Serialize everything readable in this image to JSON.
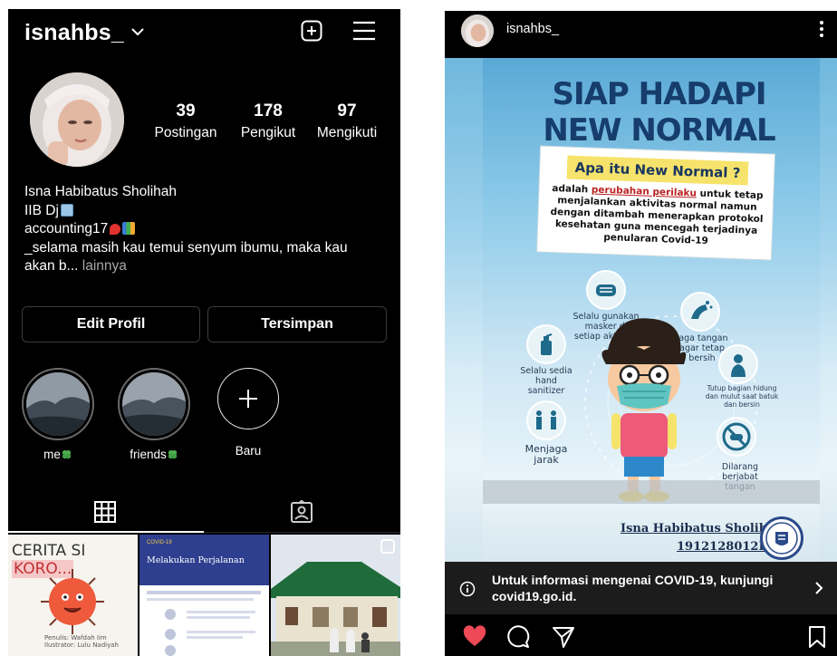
{
  "profile": {
    "username": "isnahbs_",
    "stats": [
      {
        "value": "39",
        "label": "Postingan"
      },
      {
        "value": "178",
        "label": "Pengikut"
      },
      {
        "value": "97",
        "label": "Mengikuti"
      }
    ],
    "bio": {
      "name": "Isna Habibatus Sholihah",
      "line1": "IIB Dj",
      "line2": "accounting17",
      "line3": "_selama masih kau temui senyum ibumu, maka kau",
      "line4": "akan b...",
      "more": "lainnya"
    },
    "buttons": {
      "edit": "Edit Profil",
      "saved": "Tersimpan"
    },
    "highlights": [
      {
        "label": "me"
      },
      {
        "label": "friends"
      },
      {
        "label": "Baru"
      }
    ],
    "thumbs": {
      "t1_title": "CERITA SI",
      "t1_badge": "KORO...",
      "t1_caption": "Penulis: Wafdah Iim\nIlustrator: Lulu Nadiyah",
      "t2_header": "COVID-19",
      "t2_title": "Melakukan Perjalanan"
    }
  },
  "post": {
    "username": "isnahbs_",
    "poster": {
      "title1": "SIAP HADAPI",
      "title2": "NEW NORMAL",
      "question": "Apa itu New Normal ?",
      "def_a": "adalah ",
      "def_hl": "perubahan perilaku",
      "def_b": " untuk tetap menjalankan aktivitas normal namun dengan ditambah menerapkan protokol kesehatan guna mencegah terjadinya penularan Covid-19",
      "tip_mask": "Selalu gunakan masker di setiap aktifitas",
      "tip_hands": "Jaga tangan agar tetap bersih",
      "tip_sanitizer": "Selalu sedia hand sanitizer",
      "tip_cough": "Tutup bagian hidung dan mulut saat batuk dan bersin",
      "tip_distance": "Menjaga jarak",
      "tip_handshake": "Dilarang berjabat tangan",
      "author": "Isna Habibatus Sholihah",
      "nim": "1912128012P"
    },
    "info": "Untuk informasi mengenai COVID-19, kunjungi covid19.go.id."
  },
  "colors": {
    "bg": "#000000",
    "like": "#ed4956",
    "poster_title": "#163d6c",
    "question_bg": "#f6e36b"
  }
}
